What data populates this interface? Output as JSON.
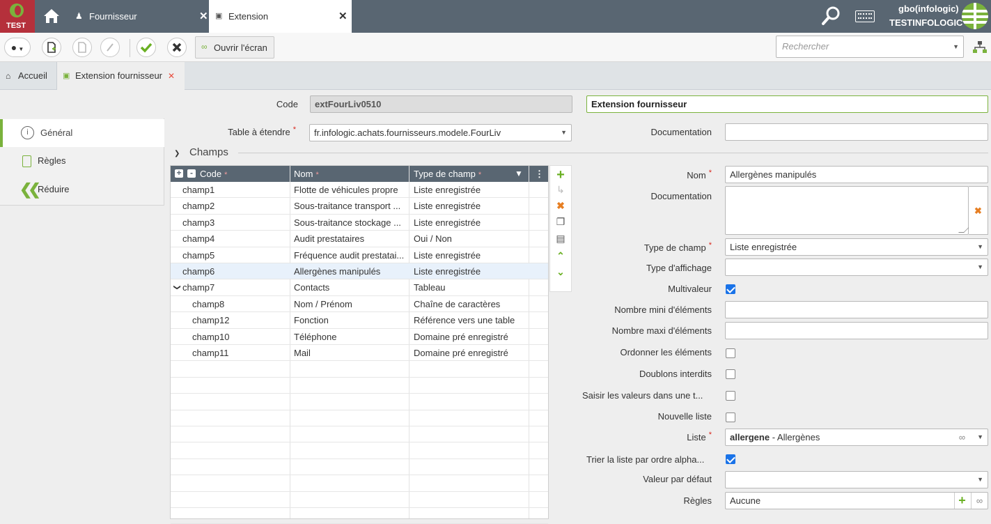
{
  "topbar": {
    "env_label": "TEST",
    "tabs": [
      {
        "label": "Fournisseur",
        "close": "✕"
      },
      {
        "label": "Extension",
        "close": "✕"
      }
    ],
    "user": "gbo(infologic)",
    "company": "TESTINFOLOGIC"
  },
  "toolbar": {
    "open_screen_label": "Ouvrir l'écran",
    "search_placeholder": "Rechercher"
  },
  "page_tabs": [
    {
      "label": "Accueil"
    },
    {
      "label": "Extension fournisseur",
      "close": "✕"
    }
  ],
  "header": {
    "code_label": "Code",
    "code_value": "extFourLiv0510",
    "title_value": "Extension fournisseur"
  },
  "sidebar": {
    "items": [
      {
        "label": "Général",
        "icon": "info-icon"
      },
      {
        "label": "Règles",
        "icon": "clipboard-icon"
      },
      {
        "label": "Réduire",
        "icon": "double-chevron-left-icon"
      }
    ]
  },
  "form": {
    "table_label": "Table à étendre",
    "table_value": "fr.infologic.achats.fournisseurs.modele.FourLiv",
    "doc_label": "Documentation",
    "doc_value": "",
    "section_label": "Champs"
  },
  "grid": {
    "columns": [
      "Code",
      "Nom",
      "Type de champ"
    ],
    "rows": [
      {
        "code": "champ1",
        "nom": "Flotte de véhicules propre",
        "type": "Liste enregistrée"
      },
      {
        "code": "champ2",
        "nom": "Sous-traitance transport ...",
        "type": "Liste enregistrée"
      },
      {
        "code": "champ3",
        "nom": "Sous-traitance stockage ...",
        "type": "Liste enregistrée"
      },
      {
        "code": "champ4",
        "nom": "Audit prestataires",
        "type": "Oui / Non"
      },
      {
        "code": "champ5",
        "nom": "Fréquence audit prestatai...",
        "type": "Liste enregistrée"
      },
      {
        "code": "champ6",
        "nom": "Allergènes manipulés",
        "type": "Liste enregistrée",
        "selected": true
      },
      {
        "code": "champ7",
        "nom": "Contacts",
        "type": "Tableau",
        "expanded": true
      },
      {
        "code": "champ8",
        "nom": "Nom / Prénom",
        "type": "Chaîne de caractères",
        "child": true
      },
      {
        "code": "champ12",
        "nom": "Fonction",
        "type": "Référence vers une table",
        "child": true
      },
      {
        "code": "champ10",
        "nom": "Téléphone",
        "type": "Domaine pré enregistré",
        "child": true
      },
      {
        "code": "champ11",
        "nom": "Mail",
        "type": "Domaine pré enregistré",
        "child": true
      }
    ]
  },
  "detail": {
    "nom_label": "Nom",
    "nom_value": "Allergènes manipulés",
    "doc_label": "Documentation",
    "doc_value": "",
    "type_label": "Type de champ",
    "type_value": "Liste enregistrée",
    "affichage_label": "Type d'affichage",
    "affichage_value": "",
    "multi_label": "Multivaleur",
    "min_label": "Nombre mini d'éléments",
    "min_value": "",
    "max_label": "Nombre maxi d'éléments",
    "max_value": "",
    "ordonner_label": "Ordonner les éléments",
    "doublons_label": "Doublons interdits",
    "saisir_label": "Saisir les valeurs dans une t...",
    "nouvelle_label": "Nouvelle liste",
    "liste_label": "Liste",
    "liste_code": "allergene",
    "liste_desc": " - Allergènes",
    "trier_label": "Trier la liste par ordre alpha...",
    "defaut_label": "Valeur par défaut",
    "defaut_value": "",
    "regles_label": "Règles",
    "regles_value": "Aucune"
  },
  "checkboxes": {
    "multivaleur": true,
    "ordonner": false,
    "doublons": false,
    "saisir": false,
    "nouvelle": false,
    "trier": true
  },
  "colors": {
    "topbar": "#596672",
    "accent_green": "#7ab23c",
    "required_red": "#d9261c",
    "checkbox_blue": "#1a73e8"
  }
}
